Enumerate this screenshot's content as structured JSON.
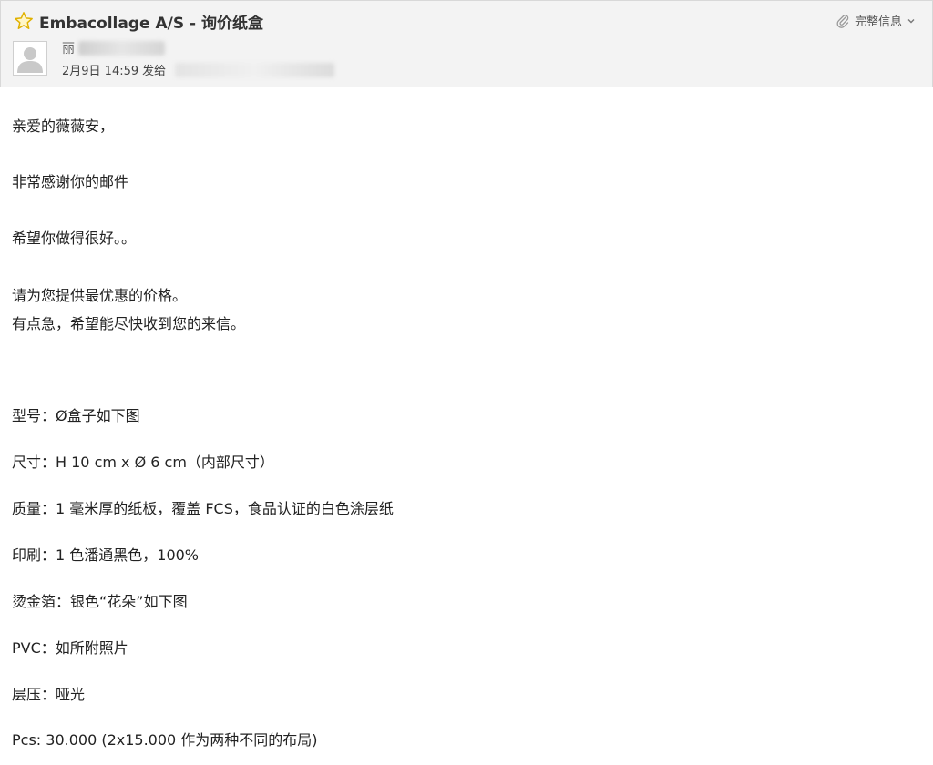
{
  "header": {
    "subject": "Embacollage A/S - 询价纸盒",
    "details_label": "完整信息",
    "sender_name": "丽",
    "date": "2月9日 14:59",
    "sent_to_label": "发给"
  },
  "icons": {
    "star": "star-outline-icon",
    "attachment": "paperclip-icon",
    "chevron": "chevron-down-icon",
    "avatar": "person-placeholder-icon"
  },
  "colors": {
    "star": "#f0c419",
    "header_bg": "#f3f3f3"
  },
  "body": {
    "greeting": "亲爱的薇薇安，",
    "line_thanks": "非常感谢你的邮件",
    "line_hope": "希望你做得很好。。",
    "line_price": "请为您提供最优惠的价格。",
    "line_urgent": "有点急，希望能尽快收到您的来信。",
    "spec_model": "型号：Ø盒子如下图",
    "spec_size": "尺寸：H 10 cm x Ø 6 cm（内部尺寸）",
    "spec_quality": "质量：1 毫米厚的纸板，覆盖 FCS，食品认证的白色涂层纸",
    "spec_print": "印刷：1 色潘通黑色，100%",
    "spec_foil": "烫金箔：银色“花朵”如下图",
    "spec_pvc": "PVC：如所附照片",
    "spec_laminate": "层压：哑光",
    "spec_pcs": "Pcs: 30.000 (2x15.000 作为两种不同的布局)"
  }
}
